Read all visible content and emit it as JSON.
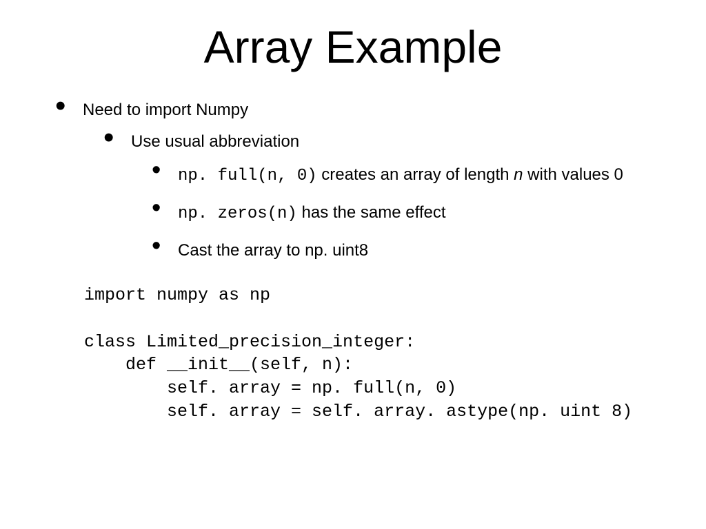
{
  "title": "Array Example",
  "bullets": {
    "l1": "Need to import Numpy",
    "l2": "Use usual abbreviation",
    "l3a_code": "np. full(n, 0)",
    "l3a_text1": " creates an array of length ",
    "l3a_em": "n",
    "l3a_text2": " with values 0",
    "l3b_code": "np. zeros(n)",
    "l3b_text": "  has the same effect",
    "l3c_text": "Cast the array to np. uint8"
  },
  "code": "import numpy as np\n\nclass Limited_precision_integer:\n    def __init__(self, n):\n        self. array = np. full(n, 0)\n        self. array = self. array. astype(np. uint 8)"
}
